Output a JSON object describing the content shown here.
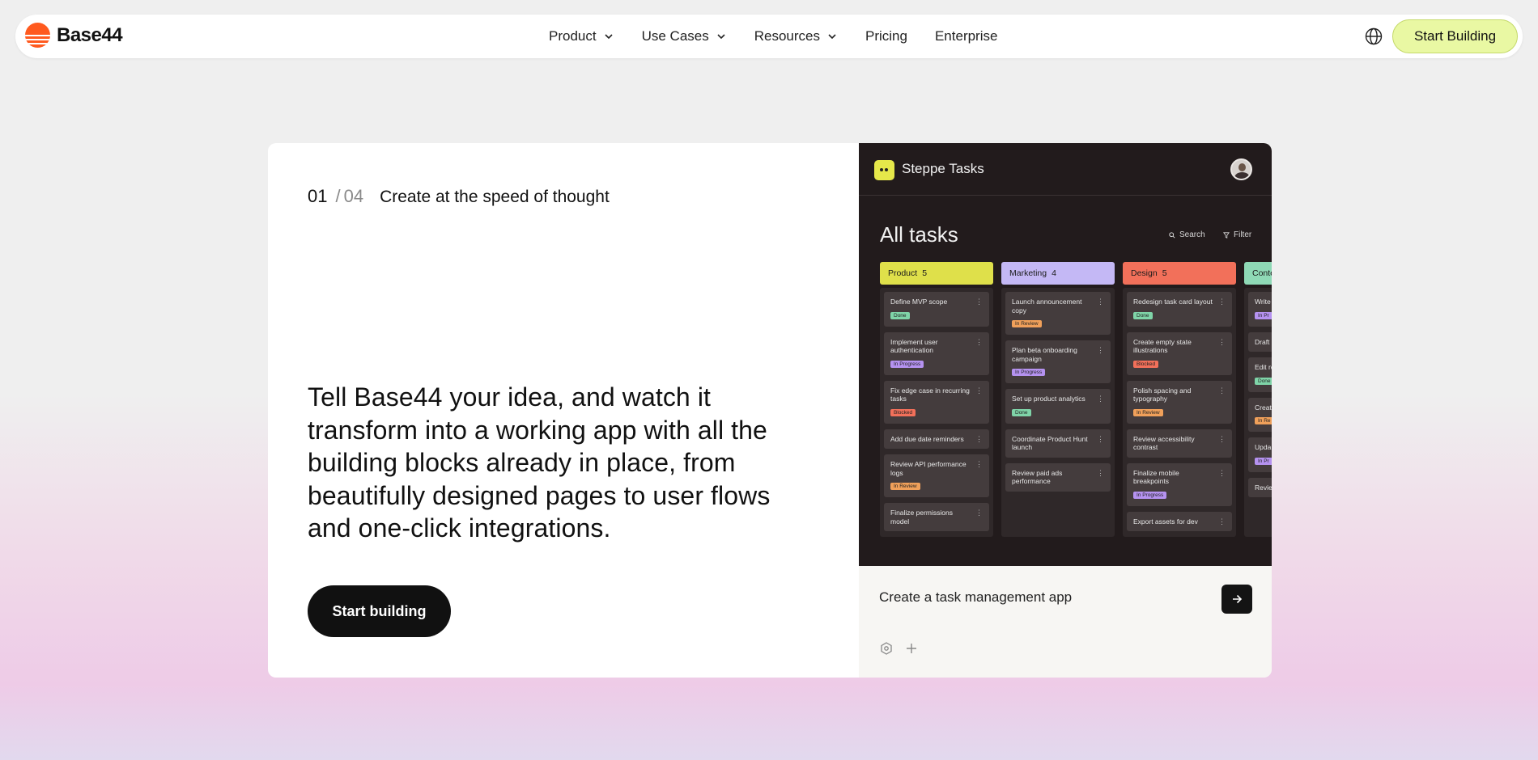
{
  "nav": {
    "logo_text": "Base44",
    "links": [
      {
        "label": "Product",
        "dropdown": true
      },
      {
        "label": "Use Cases",
        "dropdown": true
      },
      {
        "label": "Resources",
        "dropdown": true
      },
      {
        "label": "Pricing",
        "dropdown": false
      },
      {
        "label": "Enterprise",
        "dropdown": false
      }
    ],
    "language_icon": "globe-icon",
    "cta_label": "Start Building"
  },
  "hero": {
    "step_current": "01",
    "step_separator": "/",
    "step_total": "04",
    "step_title": "Create at the speed of thought",
    "headline": "Tell Base44 your idea, and watch it transform into a working app with all the building blocks already in place, from beautifully designed pages to user flows and one-click integrations.",
    "cta_label": "Start building"
  },
  "mock_app": {
    "app_name": "Steppe Tasks",
    "page_title": "All tasks",
    "search_label": "Search",
    "filter_label": "Filter",
    "columns": [
      {
        "name": "Product",
        "count": "5",
        "color": "#dfe04a",
        "tasks": [
          {
            "title": "Define MVP scope",
            "status": "Done"
          },
          {
            "title": "Implement user authentication",
            "status": "In Progress"
          },
          {
            "title": "Fix edge case in recurring tasks",
            "status": "Blocked"
          },
          {
            "title": "Add due date reminders",
            "status": ""
          },
          {
            "title": "Review API performance logs",
            "status": "In Review"
          },
          {
            "title": "Finalize permissions model",
            "status": ""
          }
        ]
      },
      {
        "name": "Marketing",
        "count": "4",
        "color": "#c4b8f5",
        "tasks": [
          {
            "title": "Launch announcement copy",
            "status": "In Review"
          },
          {
            "title": "Plan beta onboarding campaign",
            "status": "In Progress"
          },
          {
            "title": "Set up product analytics",
            "status": "Done"
          },
          {
            "title": "Coordinate Product Hunt launch",
            "status": ""
          },
          {
            "title": "Review paid ads performance",
            "status": ""
          }
        ]
      },
      {
        "name": "Design",
        "count": "5",
        "color": "#f2705a",
        "tasks": [
          {
            "title": "Redesign task card layout",
            "status": "Done"
          },
          {
            "title": "Create empty state illustrations",
            "status": "Blocked"
          },
          {
            "title": "Polish spacing and typography",
            "status": "In Review"
          },
          {
            "title": "Review accessibility contrast",
            "status": ""
          },
          {
            "title": "Finalize mobile breakpoints",
            "status": "In Progress"
          },
          {
            "title": "Export assets for dev",
            "status": ""
          }
        ]
      },
      {
        "name": "Conte",
        "count": "",
        "color": "#8fd9b6",
        "tasks": [
          {
            "title": "Write",
            "status": "In Pr"
          },
          {
            "title": "Draft",
            "status": ""
          },
          {
            "title": "Edit re",
            "status": "Done"
          },
          {
            "title": "Creat seque",
            "status": "In Re"
          },
          {
            "title": "Upda",
            "status": "In Pr"
          },
          {
            "title": "Revie",
            "status": ""
          }
        ]
      }
    ],
    "status_colors": {
      "Done": "#7fd4a8",
      "In Progress": "#b592f0",
      "Blocked": "#f2705a",
      "In Review": "#f0a05a",
      "In Pr": "#b592f0",
      "In Re": "#f0a05a"
    },
    "prompt_text": "Create a task management app",
    "send_icon": "arrow-right-icon",
    "settings_icon": "hexagon-settings-icon",
    "add_icon": "plus-icon"
  },
  "colors": {
    "accent_cta": "#e9f8a3",
    "logo_orange": "#ff5a1f",
    "dark_button": "#111111"
  }
}
